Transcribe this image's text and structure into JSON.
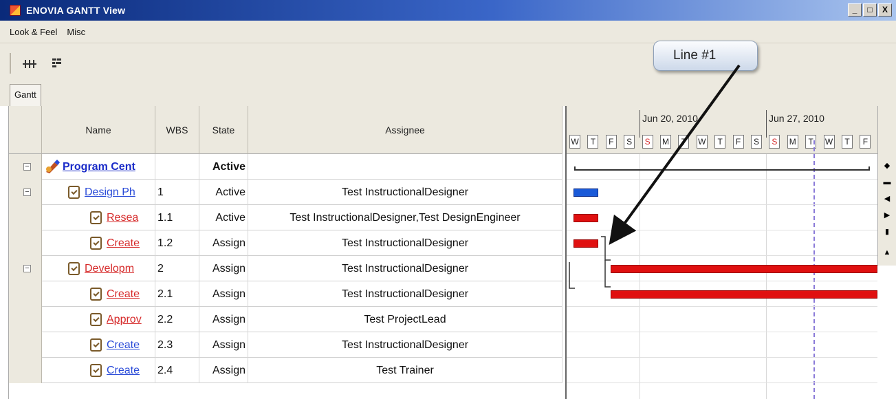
{
  "window": {
    "title": "ENOVIA GANTT View",
    "min_btn": "_",
    "max_btn": "□",
    "close_btn": "X"
  },
  "menu": [
    "Look & Feel",
    "Misc"
  ],
  "tabs": [
    "Gantt"
  ],
  "columns": {
    "name": "Name",
    "wbs": "WBS",
    "state": "State",
    "assignee": "Assignee"
  },
  "rows": [
    {
      "name": "Program Cent",
      "wbs": "",
      "state": "Active",
      "assignee": "",
      "level": 0,
      "style": "bold-blue",
      "expandable": true,
      "icon": "program-icon"
    },
    {
      "name": "Design Ph",
      "wbs": "1",
      "state": "Active",
      "assignee": "Test InstructionalDesigner",
      "level": 1,
      "style": "blue",
      "expandable": true,
      "icon": "task-icon"
    },
    {
      "name": "Resea",
      "wbs": "1.1",
      "state": "Active",
      "assignee": "Test InstructionalDesigner,Test DesignEngineer",
      "level": 2,
      "style": "red",
      "expandable": false,
      "icon": "task-icon"
    },
    {
      "name": "Create",
      "wbs": "1.2",
      "state": "Assign",
      "assignee": "Test InstructionalDesigner",
      "level": 2,
      "style": "red",
      "expandable": false,
      "icon": "task-icon"
    },
    {
      "name": "Developm",
      "wbs": "2",
      "state": "Assign",
      "assignee": "Test InstructionalDesigner",
      "level": 1,
      "style": "red",
      "expandable": true,
      "icon": "task-icon"
    },
    {
      "name": "Create",
      "wbs": "2.1",
      "state": "Assign",
      "assignee": "Test InstructionalDesigner",
      "level": 2,
      "style": "red",
      "expandable": false,
      "icon": "task-icon"
    },
    {
      "name": "Approv",
      "wbs": "2.2",
      "state": "Assign",
      "assignee": "Test ProjectLead",
      "level": 2,
      "style": "red",
      "expandable": false,
      "icon": "task-icon"
    },
    {
      "name": "Create",
      "wbs": "2.3",
      "state": "Assign",
      "assignee": "Test InstructionalDesigner",
      "level": 2,
      "style": "blue",
      "expandable": false,
      "icon": "task-icon"
    },
    {
      "name": "Create",
      "wbs": "2.4",
      "state": "Assign",
      "assignee": "Test Trainer",
      "level": 2,
      "style": "blue",
      "expandable": false,
      "icon": "task-icon"
    }
  ],
  "timeline": {
    "weeks": [
      "Jun 20, 2010",
      "Jun 27, 2010"
    ],
    "days": [
      "W",
      "T",
      "F",
      "S",
      "S",
      "M",
      "T",
      "W",
      "T",
      "F",
      "S",
      "S",
      "M",
      "T",
      "W",
      "T",
      "F"
    ],
    "sunday_color": "#d62a2a",
    "today_marker_color": "#8a7ad8"
  },
  "callout": {
    "label": "Line #1"
  }
}
